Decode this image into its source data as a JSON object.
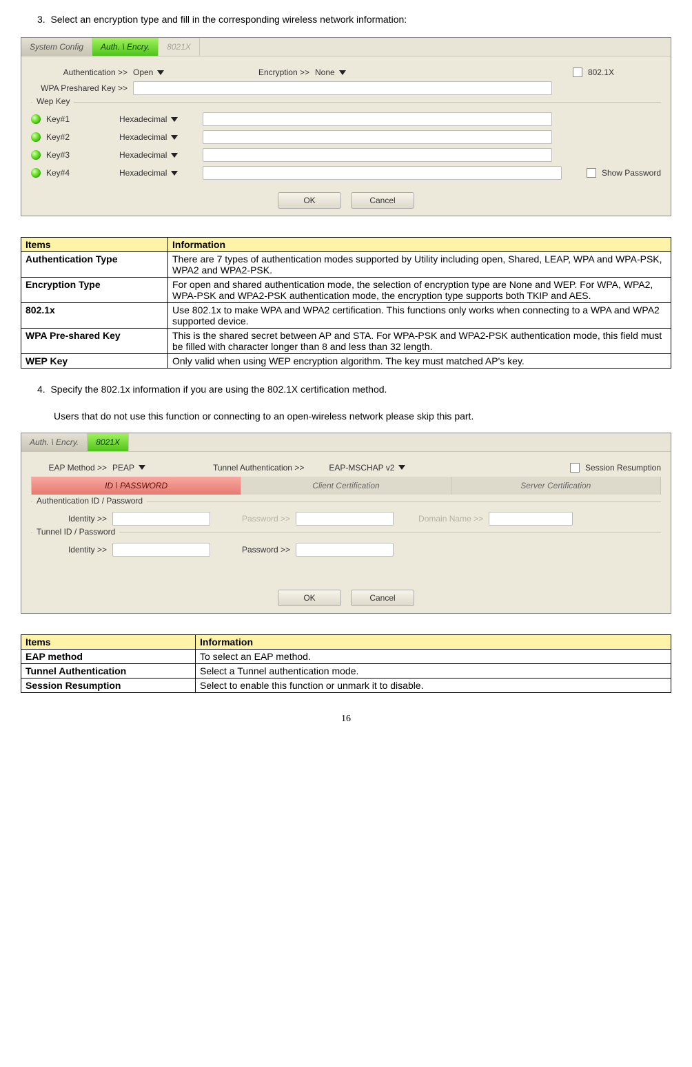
{
  "step3": {
    "num": "3.",
    "text": "Select an encryption type and fill in the corresponding wireless network information:"
  },
  "panel1": {
    "tabs": {
      "sys": "System Config",
      "auth": "Auth. \\ Encry.",
      "x": "8021X"
    },
    "authLabel": "Authentication >>",
    "authVal": "Open",
    "encLabel": "Encryption >>",
    "encVal": "None",
    "chk802": "802.1X",
    "pskLabel": "WPA Preshared Key >>",
    "wepLegend": "Wep Key",
    "keys": [
      "Key#1",
      "Key#2",
      "Key#3",
      "Key#4"
    ],
    "keyType": "Hexadecimal",
    "showPw": "Show Password",
    "ok": "OK",
    "cancel": "Cancel"
  },
  "table1": {
    "h1": "Items",
    "h2": "Information",
    "rows": [
      {
        "item": "Authentication Type",
        "info": "There are 7 types of authentication modes supported by Utility including open, Shared, LEAP, WPA and WPA-PSK, WPA2 and WPA2-PSK."
      },
      {
        "item": "Encryption Type",
        "info": "For open and shared authentication mode, the selection of encryption type are None and WEP. For WPA, WPA2, WPA-PSK and WPA2-PSK authentication mode, the encryption type supports both TKIP and AES."
      },
      {
        "item": "802.1x",
        "info": "Use 802.1x to make WPA and WPA2 certification. This functions only works when connecting to a WPA and WPA2 supported device."
      },
      {
        "item": "WPA Pre-shared Key",
        "info": "This is the shared secret between AP and STA. For WPA-PSK and WPA2-PSK authentication mode, this field must be filled with character longer than 8 and less than 32 length."
      },
      {
        "item": "WEP Key",
        "info": "Only valid when using WEP encryption algorithm. The key must matched AP's key."
      }
    ]
  },
  "step4": {
    "num": "4.",
    "text": "Specify the 802.1x information if you are using the 802.1X certification method.",
    "sub": "Users that do not use this function or connecting to an open-wireless network please skip this part."
  },
  "panel2": {
    "tabs": {
      "auth": "Auth. \\ Encry.",
      "x": "8021X"
    },
    "eapLabel": "EAP Method >>",
    "eapVal": "PEAP",
    "tunLabel": "Tunnel Authentication >>",
    "tunVal": "EAP-MSCHAP v2",
    "sessRes": "Session Resumption",
    "subtabs": {
      "id": "ID \\ PASSWORD",
      "client": "Client Certification",
      "server": "Server Certification"
    },
    "grp1": "Authentication ID / Password",
    "grp2": "Tunnel ID / Password",
    "identity": "Identity >>",
    "password": "Password >>",
    "domain": "Domain Name >>",
    "ok": "OK",
    "cancel": "Cancel"
  },
  "table2": {
    "h1": "Items",
    "h2": "Information",
    "rows": [
      {
        "item": "EAP method",
        "info": "To select an EAP method."
      },
      {
        "item": "Tunnel Authentication",
        "info": "Select a Tunnel authentication mode."
      },
      {
        "item": "Session Resumption",
        "info": "Select to enable this function or unmark it to disable."
      }
    ]
  },
  "pageNumber": "16"
}
